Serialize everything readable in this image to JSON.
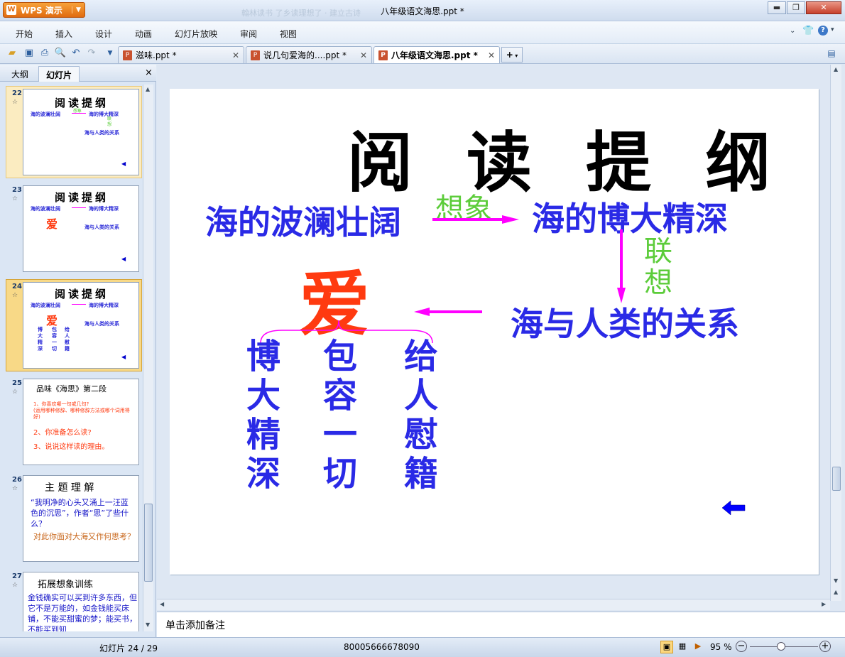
{
  "app": {
    "button_label": "WPS 演示",
    "title": "八年级语文海思.ppt *",
    "ghost_text": "翰林读书 了乡读理想了 · 建立古诗"
  },
  "menu": [
    "开始",
    "插入",
    "设计",
    "动画",
    "幻灯片放映",
    "审阅",
    "视图"
  ],
  "tabs": [
    {
      "label": "滋味.ppt *"
    },
    {
      "label": "说几句爱海的....ppt *"
    },
    {
      "label": "八年级语文海思.ppt *"
    }
  ],
  "panel": {
    "tabs": [
      "大纲",
      "幻灯片"
    ],
    "close": "×"
  },
  "thumbnails": [
    {
      "num": "22",
      "title": "阅读提纲",
      "t1": "海的波澜壮阔",
      "t2": "海的博大精深",
      "t3": "海与人类的关系",
      "g1": "想象",
      "g2": "联想"
    },
    {
      "num": "23",
      "title": "阅读提纲",
      "t1": "海的波澜壮阔",
      "t2": "海的博大精深",
      "t3": "海与人类的关系",
      "love": "爱"
    },
    {
      "num": "24",
      "title": "阅读提纲",
      "t1": "海的波澜壮阔",
      "t2": "海的博大精深",
      "t3": "海与人类的关系",
      "love": "爱",
      "c1": "博大精深",
      "c2": "包容一切",
      "c3": "给人慰籍"
    },
    {
      "num": "25",
      "title": "品味《海思》第二段",
      "q1": "1、你喜欢哪一句或几句?",
      "q1b": "(运用哪种修辞、哪种修辞方法或哪个词用得好)",
      "q2": "2、你准备怎么读?",
      "q3": "3、说说这样读的理由。"
    },
    {
      "num": "26",
      "title": "主 题 理 解",
      "p1": "“我明净的心头又涌上一汪蓝色的沉思”，作者“思”了些什么？",
      "p2": "对此你面对大海又作何思考？"
    },
    {
      "num": "27",
      "title": "拓展想象训练",
      "p1": "金钱确实可以买到许多东西，但它不是万能的，如金钱能买床铺，不能买甜蜜的梦；能买书，不能买到知"
    }
  ],
  "slide": {
    "title": "阅 读 提 纲",
    "t1": "海的波澜壮阔",
    "t2": "海的博大精深",
    "t3": "海与人类的关系",
    "xiang": "想象",
    "lian": "联",
    "xiang2": "想",
    "love": "爱",
    "col1": [
      "博",
      "大",
      "精",
      "深"
    ],
    "col2": [
      "包",
      "容",
      "一",
      "切"
    ],
    "col3": [
      "给",
      "人",
      "慰",
      "籍"
    ]
  },
  "notes": "单击添加备注",
  "status": {
    "slide": "幻灯片 24 / 29",
    "code": "80005666678090",
    "zoom": "95 %"
  },
  "colors": {
    "blue": "#2a2ae6",
    "green": "#5ccc3a",
    "red": "#ff3a10",
    "magenta": "#ff00ff"
  }
}
